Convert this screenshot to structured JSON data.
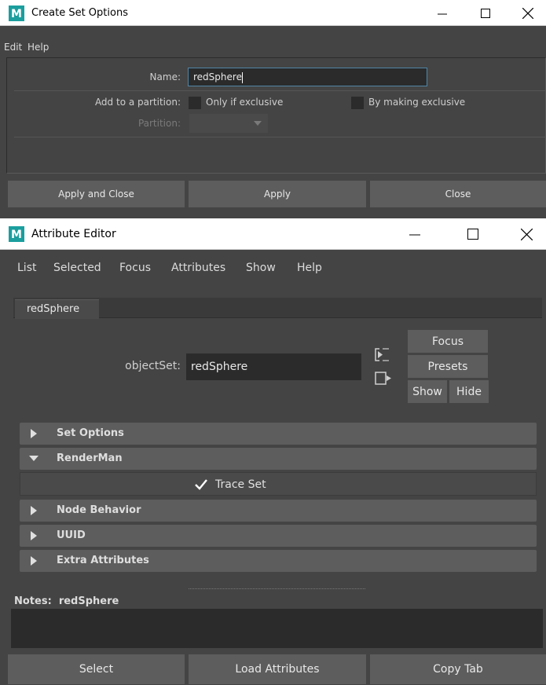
{
  "create_set": {
    "title": "Create Set Options",
    "menu": [
      "Edit",
      "Help"
    ],
    "name_label": "Name:",
    "name_value": "redSphere",
    "partition_label": "Add to a partition:",
    "only_exclusive_label": "Only if exclusive",
    "making_exclusive_label": "By making exclusive",
    "partition_field_label": "Partition:",
    "buttons": {
      "apply_close": "Apply and Close",
      "apply": "Apply",
      "close": "Close"
    }
  },
  "attribute_editor": {
    "title": "Attribute Editor",
    "menu": [
      "List",
      "Selected",
      "Focus",
      "Attributes",
      "Show",
      "Help"
    ],
    "tab_label": "redSphere",
    "object_set_label": "objectSet:",
    "object_set_value": "redSphere",
    "side_buttons": {
      "focus": "Focus",
      "presets": "Presets",
      "show": "Show",
      "hide": "Hide"
    },
    "sections": {
      "set_options": "Set Options",
      "renderman": "RenderMan",
      "node_behavior": "Node Behavior",
      "uuid": "UUID",
      "extra_attributes": "Extra Attributes"
    },
    "trace_set_label": "Trace Set",
    "trace_set_checked": true,
    "notes_label": "Notes:  redSphere",
    "buttons": {
      "select": "Select",
      "load_attributes": "Load Attributes",
      "copy_tab": "Copy Tab"
    }
  },
  "icons": [
    "maya-logo-icon",
    "minimize-icon",
    "maximize-icon",
    "close-icon",
    "expand-arrow-icon",
    "collapse-arrow-icon",
    "checkmark-icon",
    "dropdown-arrow-icon",
    "input-connection-icon",
    "output-connection-icon"
  ],
  "colors": {
    "background": "#444444",
    "field": "#2b2b2b",
    "button": "#5d5d5d",
    "logo_teal": "#1b9e9e"
  }
}
